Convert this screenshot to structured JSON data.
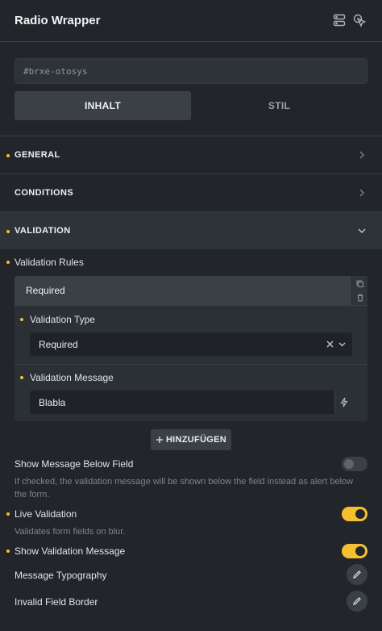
{
  "header": {
    "title": "Radio Wrapper"
  },
  "element_id": {
    "value": "#brxe-otosys"
  },
  "tabs": {
    "content": "INHALT",
    "style": "STIL"
  },
  "sections": [
    {
      "label": "GENERAL",
      "state": "collapsed"
    },
    {
      "label": "CONDITIONS",
      "state": "collapsed"
    },
    {
      "label": "VALIDATION",
      "state": "expanded"
    }
  ],
  "validation": {
    "rules_label": "Validation Rules",
    "rule": {
      "title": "Required",
      "type_label": "Validation Type",
      "type_value": "Required",
      "message_label": "Validation Message",
      "message_value": "Blabla"
    },
    "add_label": "HINZUFÜGEN",
    "show_below": {
      "label": "Show Message Below Field",
      "help": "If checked, the validation message will be shown below the field instead as alert below the form.",
      "on": false
    },
    "live": {
      "label": "Live Validation",
      "help": "Validates form fields on blur.",
      "on": true
    },
    "show_message": {
      "label": "Show Validation Message",
      "on": true
    },
    "typography_label": "Message Typography",
    "border_label": "Invalid Field Border"
  },
  "colors": {
    "accent": "#f5c02f",
    "panel": "#22262b",
    "control": "#3b4047"
  }
}
